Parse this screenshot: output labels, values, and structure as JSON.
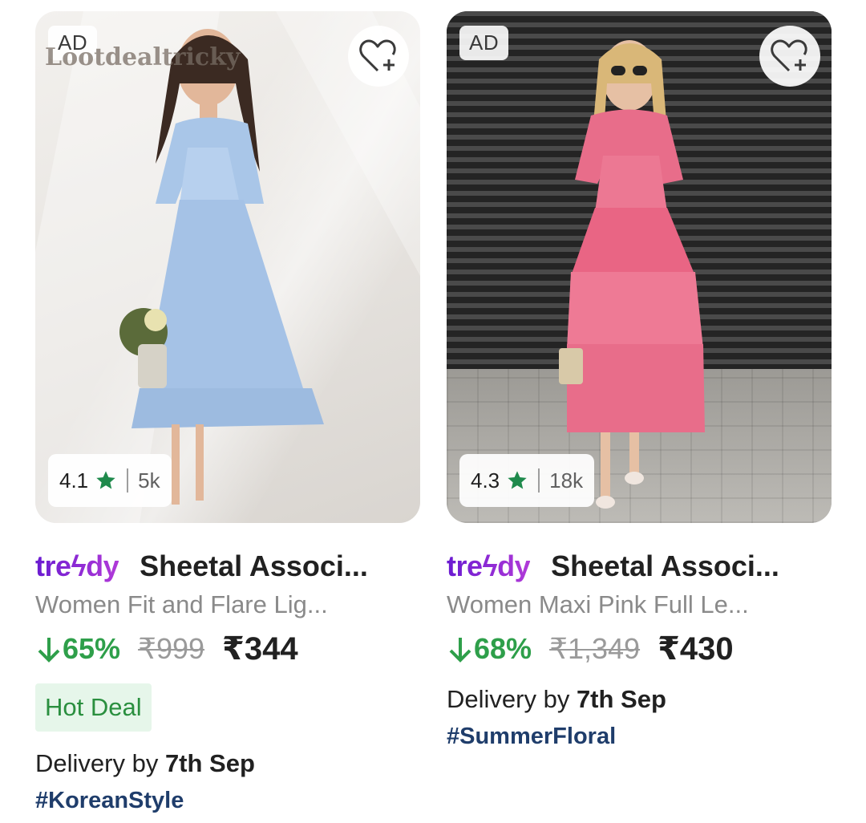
{
  "products": [
    {
      "ad_label": "AD",
      "watermark": "Lootdealtricky",
      "rating": "4.1",
      "rating_count": "5k",
      "seller_logo": "treϟdy",
      "brand": "Sheetal Associ...",
      "title": "Women Fit and Flare Lig...",
      "discount": "65%",
      "mrp": "₹999",
      "price": "₹344",
      "badge": "Hot Deal",
      "delivery_prefix": "Delivery by ",
      "delivery_date": "7th Sep",
      "hashtag": "#KoreanStyle"
    },
    {
      "ad_label": "AD",
      "rating": "4.3",
      "rating_count": "18k",
      "seller_logo": "treϟdy",
      "brand": "Sheetal Associ...",
      "title": "Women Maxi Pink Full Le...",
      "discount": "68%",
      "mrp": "₹1,349",
      "price": "₹430",
      "delivery_prefix": "Delivery by ",
      "delivery_date": "7th Sep",
      "hashtag": "#SummerFloral"
    }
  ],
  "colors": {
    "discount_green": "#2e9f4a",
    "star_green": "#1f8a4c",
    "hot_deal_bg": "#e6f6ea",
    "hashtag_blue": "#1f3d6b",
    "trendy_purple": "#8a2be2"
  },
  "icons": [
    "wishlist-add-icon",
    "star-icon",
    "down-arrow-icon"
  ]
}
